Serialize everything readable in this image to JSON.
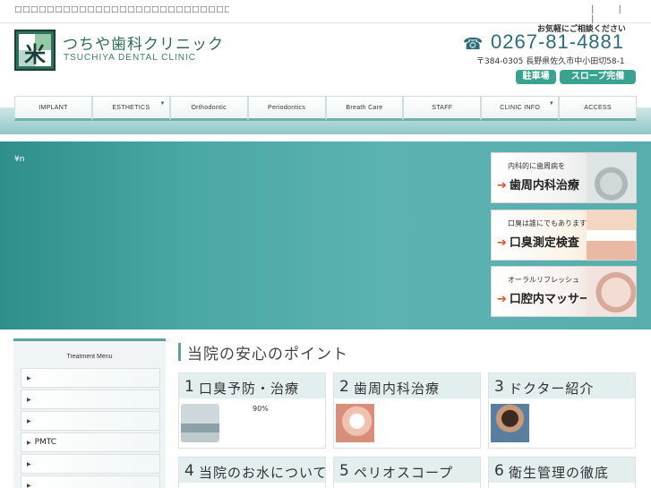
{
  "topbar": {
    "tagline": "□□□□□□□□□□□□□□□□□□□□□□□□□□□□□□□□ □□□□□□□□□□□",
    "pipes": "| | |"
  },
  "logo": {
    "mark": "米",
    "name_jp": "つちや歯科クリニック",
    "name_en": "TSUCHIYA DENTAL CLINIC"
  },
  "contact": {
    "consult": "お気軽にご相談ください",
    "phone_icon": "☎",
    "phone": "0267-81-4881",
    "address": "〒384-0305 長野県佐久市中小田切58-1",
    "badges": [
      "駐車場",
      "スロープ完備"
    ]
  },
  "nav": {
    "items": [
      {
        "label": "IMPLANT",
        "dropdown": false
      },
      {
        "label": "ESTHETICS",
        "dropdown": true
      },
      {
        "label": "Orthodontic",
        "dropdown": false
      },
      {
        "label": "Periodontics",
        "dropdown": false
      },
      {
        "label": "Breath Care",
        "dropdown": false
      },
      {
        "label": "STAFF",
        "dropdown": false
      },
      {
        "label": "CLINIC INFO",
        "dropdown": true
      },
      {
        "label": "ACCESS",
        "dropdown": false
      }
    ],
    "dropdown_arrow": "▼"
  },
  "hero": {
    "text": "¥n"
  },
  "banners": [
    {
      "sub": "内科的に歯周病を",
      "main": "歯周内科治療",
      "arrow": "➔"
    },
    {
      "sub": "口臭は誰にでもあります",
      "main": "口臭測定検査",
      "arrow": "➔"
    },
    {
      "sub": "オーラルリフレッシュ",
      "main": "口腔内マッサージ",
      "arrow": "➔"
    }
  ],
  "sidebar": {
    "heading": "Treatment Menu",
    "bullet": "▶",
    "items": [
      "",
      "",
      "",
      "PMTC",
      "",
      ""
    ]
  },
  "points": {
    "title": "当院の安心のポイント",
    "cards": [
      {
        "num": "1",
        "title": "口臭予防・治療",
        "pct": "90%"
      },
      {
        "num": "2",
        "title": "歯周内科治療",
        "pct": ""
      },
      {
        "num": "3",
        "title": "ドクター紹介",
        "pct": ""
      },
      {
        "num": "4",
        "title": "当院のお水について",
        "pct": ""
      },
      {
        "num": "5",
        "title": "ペリオスコープ",
        "pct": ""
      },
      {
        "num": "6",
        "title": "衛生管理の徹底",
        "pct": ""
      }
    ]
  },
  "colors": {
    "accent": "#5aa39f",
    "brand_text": "#2d6b59",
    "badge": "#3aa38f",
    "hero": "#4aa8a5",
    "arrow": "#e0532f"
  }
}
